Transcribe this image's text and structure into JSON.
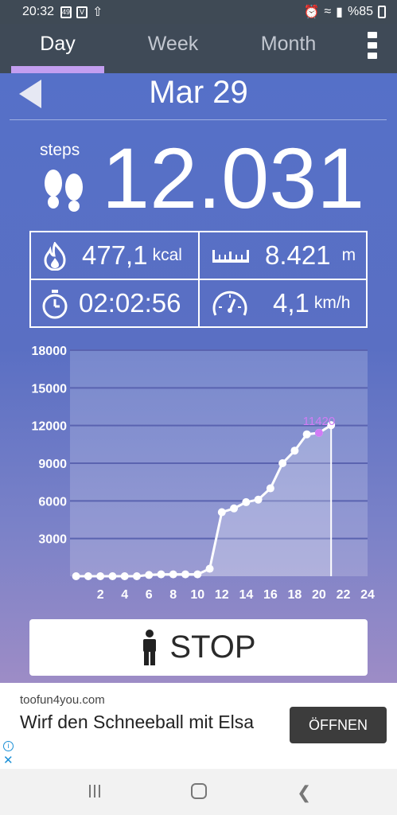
{
  "status_bar": {
    "time": "20:32",
    "notif_icons": [
      "49",
      "V",
      "⇧"
    ],
    "battery": "%85"
  },
  "tabs": [
    {
      "label": "Day",
      "active": true
    },
    {
      "label": "Week",
      "active": false
    },
    {
      "label": "Month",
      "active": false
    }
  ],
  "date": "Mar 29",
  "steps": {
    "label": "steps",
    "value": "12.031"
  },
  "stats": {
    "calories": {
      "value": "477,1",
      "unit": "kcal"
    },
    "distance": {
      "value": "8.421",
      "unit": "m"
    },
    "duration": {
      "value": "02:02:56"
    },
    "speed": {
      "value": "4,1",
      "unit": "km/h"
    }
  },
  "chart_data": {
    "type": "line",
    "title": "",
    "xlabel": "",
    "ylabel": "",
    "x_ticks": [
      "2",
      "4",
      "6",
      "8",
      "10",
      "12",
      "14",
      "16",
      "18",
      "20",
      "22",
      "24"
    ],
    "y_ticks": [
      "18000",
      "15000",
      "12000",
      "9000",
      "6000",
      "3000"
    ],
    "xlim": [
      -0.5,
      24
    ],
    "ylim": [
      0,
      18000
    ],
    "grid": true,
    "series": [
      {
        "x": [
          0,
          1,
          2,
          3,
          4,
          5,
          6,
          7,
          8,
          9,
          10,
          11,
          12,
          13,
          14,
          15,
          16,
          17,
          18,
          19,
          20,
          21
        ],
        "values": [
          0,
          0,
          0,
          0,
          0,
          0,
          100,
          150,
          150,
          150,
          150,
          600,
          5100,
          5400,
          5900,
          6100,
          7000,
          9000,
          10000,
          11300,
          11420,
          12031
        ]
      }
    ],
    "highlight": {
      "x": 20,
      "y": 11420,
      "label": "11420",
      "color": "#d07cf5"
    }
  },
  "stop_button": {
    "label": "STOP"
  },
  "ad": {
    "domain": "toofun4you.com",
    "headline": "Wirf den Schneeball mit Elsa",
    "cta": "ÖFFNEN"
  }
}
